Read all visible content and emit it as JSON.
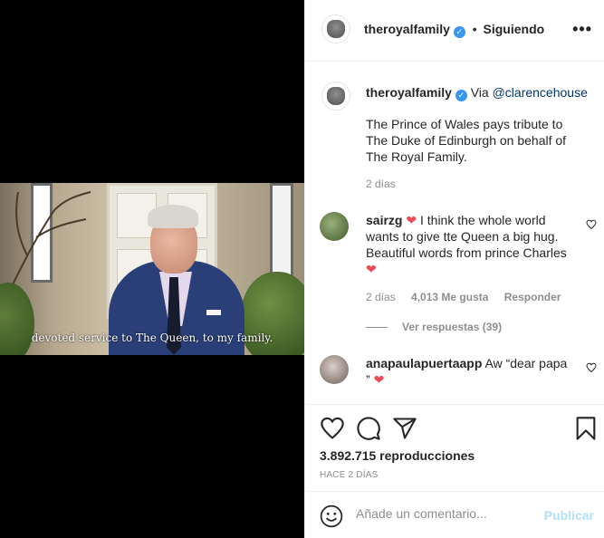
{
  "video": {
    "subtitle": "devoted service to The Queen, to my family."
  },
  "header": {
    "username": "theroyalfamily",
    "separator": "•",
    "follow_status": "Siguiendo",
    "more_icon": "more-options-icon"
  },
  "caption": {
    "username": "theroyalfamily",
    "via_label": "Via",
    "mention": "@clarencehouse",
    "text": "The Prince of Wales pays tribute to The Duke of Edinburgh on behalf of The Royal Family.",
    "time": "2 días"
  },
  "comments": [
    {
      "username": "sairzg",
      "heart": "❤",
      "text_before": "I think the whole world wants to give tte Queen a big hug. Beautiful words from prince Charles",
      "heart_after": "❤",
      "time": "2 días",
      "likes": "4,013 Me gusta",
      "reply_label": "Responder",
      "view_replies": "Ver respuestas (39)"
    },
    {
      "username": "anapaulapuertaapp",
      "text_before": "Aw “dear papa ”",
      "heart_after": "❤"
    }
  ],
  "actions": {
    "views": "3.892.715 reproducciones",
    "timestamp": "HACE 2 DÍAS"
  },
  "comment_box": {
    "placeholder": "Añade un comentario...",
    "publish_label": "Publicar"
  },
  "colors": {
    "verified": "#3897f0",
    "heart": "#ed4956",
    "publish_disabled": "#b2dffc",
    "meta_gray": "#8e8e8e"
  }
}
